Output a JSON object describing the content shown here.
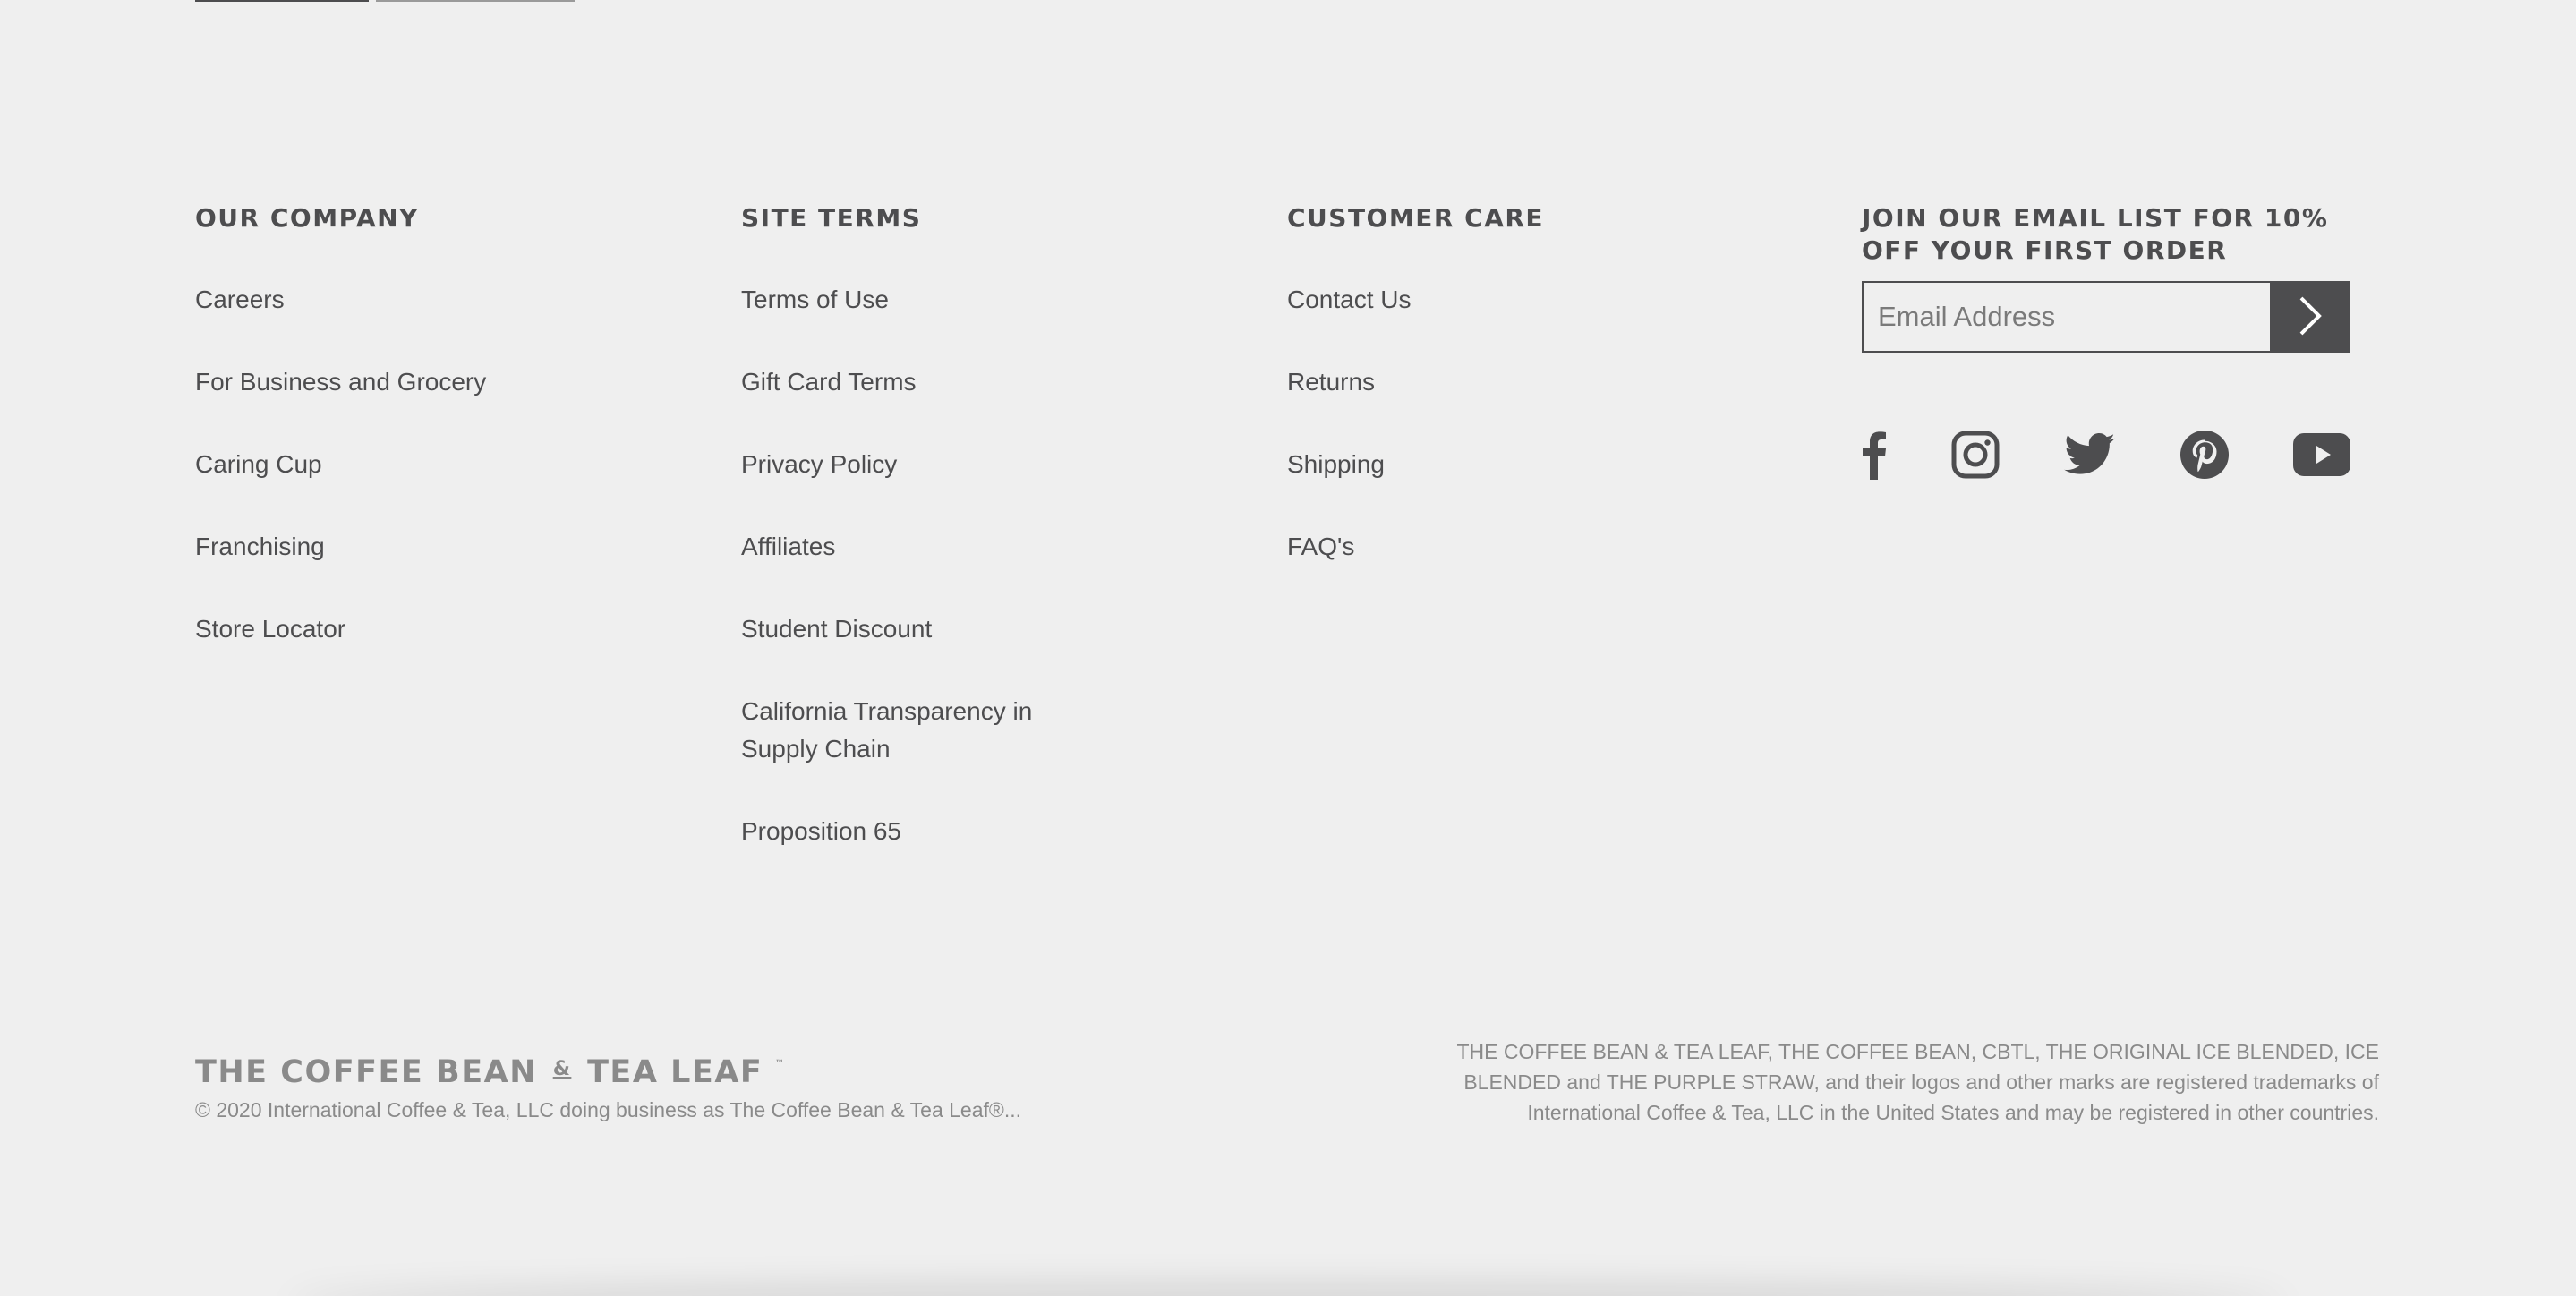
{
  "footer": {
    "company": {
      "heading": "OUR COMPANY",
      "items": [
        "Careers",
        "For Business and Grocery",
        "Caring Cup",
        "Franchising",
        "Store Locator"
      ]
    },
    "terms": {
      "heading": "SITE TERMS",
      "items": [
        "Terms of Use",
        "Gift Card Terms",
        "Privacy Policy",
        "Affiliates",
        "Student Discount",
        "California Transparency in Supply Chain",
        "Proposition 65"
      ]
    },
    "care": {
      "heading": "CUSTOMER CARE",
      "items": [
        "Contact Us",
        "Returns",
        "Shipping",
        "FAQ's"
      ]
    },
    "email": {
      "heading": "JOIN OUR EMAIL LIST FOR 10% OFF YOUR FIRST ORDER",
      "placeholder": "Email Address"
    },
    "social": [
      "facebook-icon",
      "instagram-icon",
      "twitter-icon",
      "pinterest-icon",
      "youtube-icon"
    ],
    "brand": {
      "part1": "THE COFFEE BEAN",
      "amp": "&",
      "part2": "TEA LEAF",
      "tm": "™"
    },
    "copyright": "© 2020 International Coffee & Tea, LLC doing business as The Coffee Bean & Tea Leaf®...",
    "trademark": "THE COFFEE BEAN & TEA LEAF, THE COFFEE BEAN, CBTL, THE ORIGINAL ICE BLENDED, ICE BLENDED and THE PURPLE STRAW, and their logos and other marks are registered trademarks of International Coffee & Tea, LLC in the United States and may be registered in other countries."
  },
  "colors": {
    "background": "#efefef",
    "text": "#4d4d4f",
    "muted": "#8a8a8a"
  }
}
